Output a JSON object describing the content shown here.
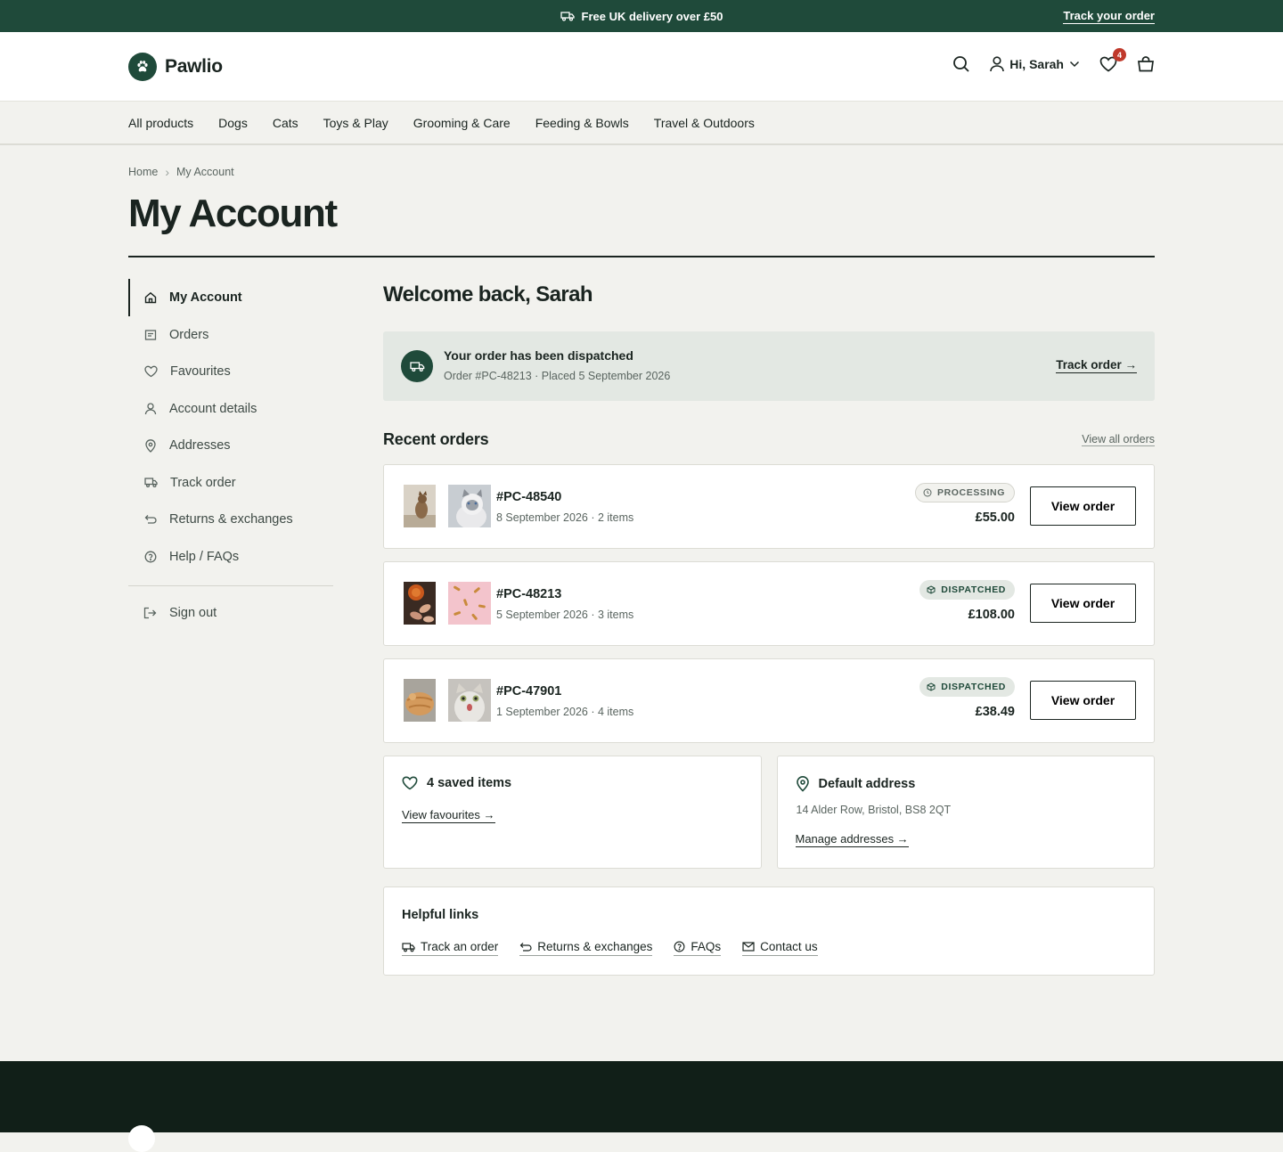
{
  "topbar": {
    "promo_icon": "truck-icon",
    "promo_text": "Free UK delivery over £50",
    "track_link": "Track your order"
  },
  "header": {
    "brand": "Pawlio",
    "user_greeting": "Hi, Sarah",
    "favourites_count": "4"
  },
  "nav": {
    "items": [
      "All products",
      "Dogs",
      "Cats",
      "Toys & Play",
      "Grooming & Care",
      "Feeding & Bowls",
      "Travel & Outdoors"
    ]
  },
  "breadcrumb": {
    "home": "Home",
    "separator": "›",
    "current": "My Account"
  },
  "page_title": "My Account",
  "sidebar": {
    "items": [
      {
        "label": "My Account",
        "icon": "home-icon"
      },
      {
        "label": "Orders",
        "icon": "receipt-icon"
      },
      {
        "label": "Favourites",
        "icon": "heart-icon"
      },
      {
        "label": "Account details",
        "icon": "user-icon"
      },
      {
        "label": "Addresses",
        "icon": "location-pin-icon"
      },
      {
        "label": "Track order",
        "icon": "truck-icon"
      },
      {
        "label": "Returns & exchanges",
        "icon": "return-arrow-icon"
      },
      {
        "label": "Help / FAQs",
        "icon": "question-circle-icon"
      }
    ],
    "sign_out": "Sign out"
  },
  "welcome": "Welcome back, Sarah",
  "alert": {
    "title": "Your order has been dispatched",
    "subtitle": "Order #PC-48213 · Placed 5 September 2026",
    "link": "Track order →"
  },
  "recent_orders": {
    "title": "Recent orders",
    "view_all": "View all orders",
    "button_label": "View order",
    "orders": [
      {
        "id": "#PC-48540",
        "meta": "8 September 2026 · 2 items",
        "status": "PROCESSING",
        "price": "£55.00"
      },
      {
        "id": "#PC-48213",
        "meta": "5 September 2026 · 3 items",
        "status": "DISPATCHED",
        "price": "£108.00"
      },
      {
        "id": "#PC-47901",
        "meta": "1 September 2026 · 4 items",
        "status": "DISPATCHED",
        "price": "£38.49"
      }
    ]
  },
  "saved": {
    "title": "4 saved items",
    "link": "View favourites →"
  },
  "address": {
    "title": "Default address",
    "value": "14 Alder Row, Bristol, BS8 2QT",
    "link": "Manage addresses →"
  },
  "helpful": {
    "title": "Helpful links",
    "links": [
      "Track an order",
      "Returns & exchanges",
      "FAQs",
      "Contact us"
    ]
  },
  "colors": {
    "brand_green": "#1f4a3a",
    "background": "#f2f2ee",
    "badge_red": "#c0392b",
    "footer": "#111f18"
  }
}
